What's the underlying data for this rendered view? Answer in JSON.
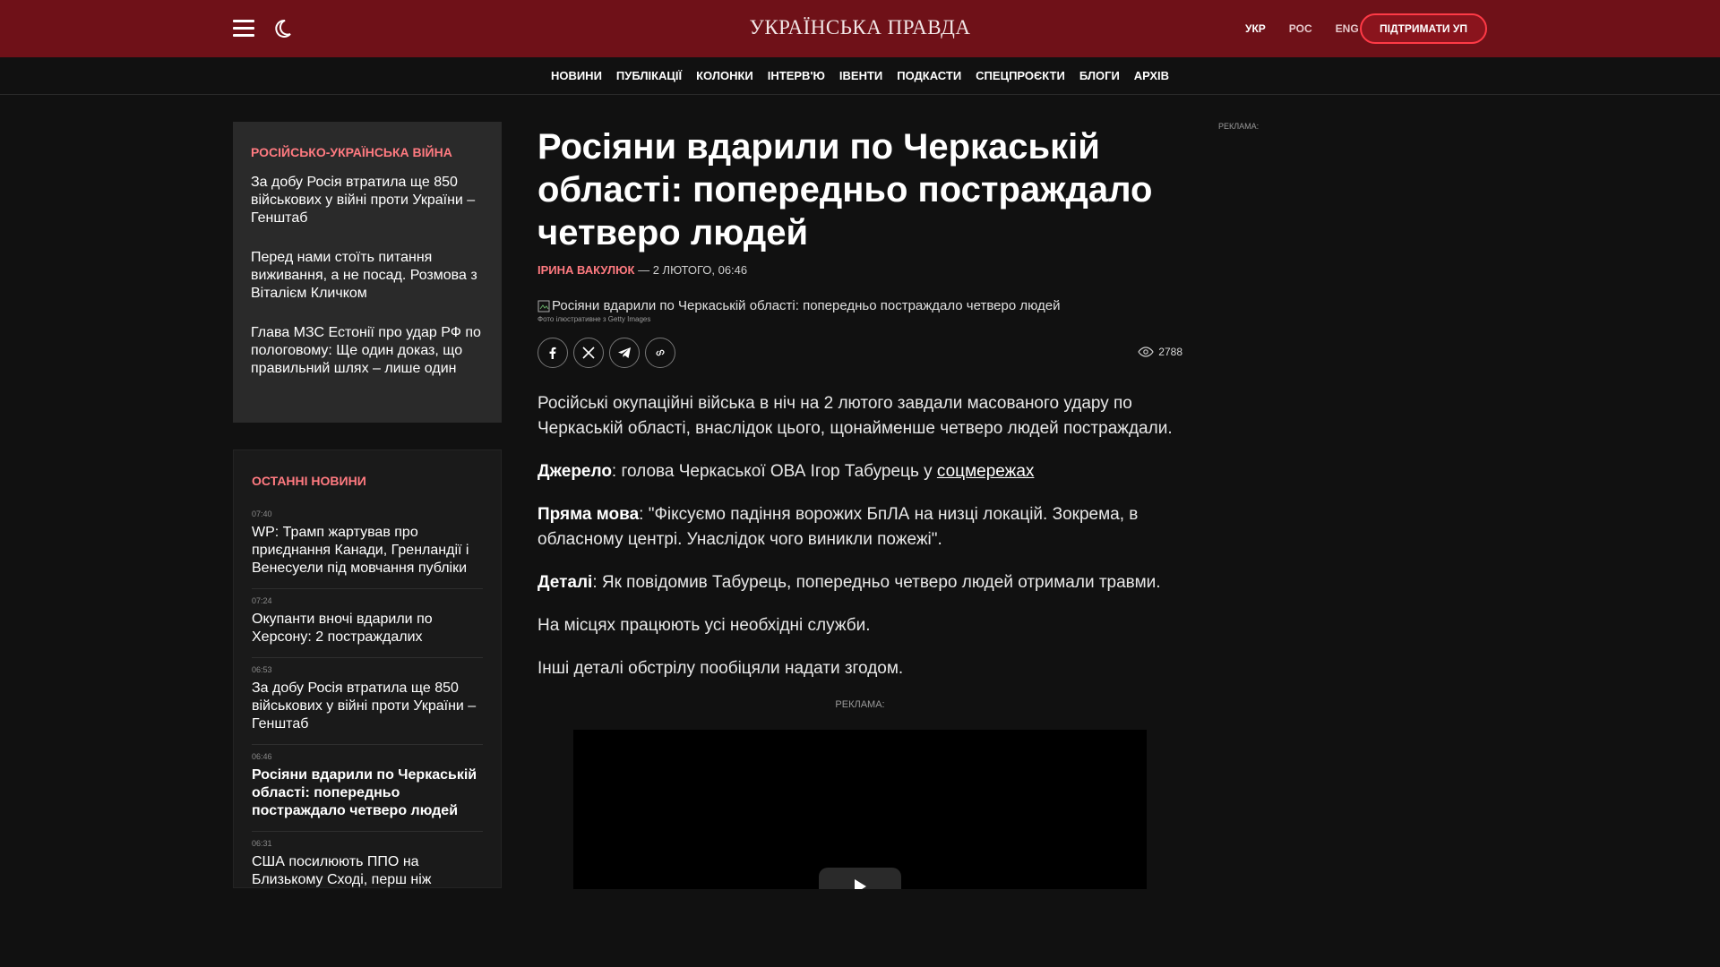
{
  "header": {
    "logo": "УКРАЇНСЬКА ПРАВДА",
    "langs": [
      "УКР",
      "РОС",
      "ENG"
    ],
    "support_label": "ПІДТРИМАТИ УП"
  },
  "nav": [
    "НОВИНИ",
    "ПУБЛІКАЦІЇ",
    "КОЛОНКИ",
    "ІНТЕРВ'Ю",
    "ІВЕНТИ",
    "ПОДКАСТИ",
    "СПЕЦПРОЄКТИ",
    "БЛОГИ",
    "АРХІВ"
  ],
  "war_panel": {
    "title": "РОСІЙСЬКО-УКРАЇНСЬКА ВІЙНА",
    "items": [
      "За добу Росія втратила ще 850 військових у війні проти України – Генштаб",
      "Перед нами стоїть питання виживання, а не посад. Розмова з Віталієм Кличком",
      "Глава МЗС Естонії про удар РФ по пологовому: Ще один доказ, що правильний шлях – лише один"
    ]
  },
  "latest_news": {
    "title": "ОСТАННІ НОВИНИ",
    "items": [
      {
        "time": "07:40",
        "text": "WP: Трамп жартував про приєднання Канади, Гренландії і Венесуели під мовчання публіки"
      },
      {
        "time": "07:24",
        "text": "Окупанти вночі вдарили по Херсону: 2 постраждалих"
      },
      {
        "time": "06:53",
        "text": "За добу Росія втратила ще 850 військових у війні проти України – Генштаб"
      },
      {
        "time": "06:46",
        "text": "Росіяни вдарили по Черкаській області: попередньо постраждало четверо людей"
      },
      {
        "time": "06:31",
        "text": "США посилюють ППО на Близькому Сході, перш ніж"
      }
    ]
  },
  "article": {
    "headline": "Росіяни вдарили по Черкаській області: попередньо постраждало четверо людей",
    "author": "ІРИНА ВАКУЛЮК",
    "date": " — 2 ЛЮТОГО, 06:46",
    "photo_alt": "Росіяни вдарили по Черкаській області: попередньо постраждало четверо людей",
    "photo_credit": "Фото ілюстративне з Getty Images",
    "views": "2788",
    "p1": "Російські окупаційні війська в ніч на 2 лютого завдали масованого удару по Черкаській області, внаслідок цього, щонайменше четверо людей постраждали.",
    "p2_label": "Джерело",
    "p2_text": ": голова Черкаської ОВА Ігор Табурець у ",
    "p2_link": "соцмережах",
    "p3_label": "Пряма мова",
    "p3_text": ": \"Фіксуємо падіння ворожих БпЛА на низці локацій. Зокрема, в обласному центрі. Унаслідок чого виникли пожежі\".",
    "p4_label": "Деталі",
    "p4_text": ": Як повідомив Табурець, попередньо четверо людей отримали травми.",
    "p5": "На місцях працюють усі необхідні служби.",
    "p6": "Інші деталі обстрілу пообіцяли надати згодом.",
    "ad_label": "РЕКЛАМА:"
  },
  "right_ad_label": "РЕКЛАМА:",
  "colors": {
    "header_bg": "#6f1118",
    "accent": "#ff7a80",
    "page_bg": "#111111"
  }
}
